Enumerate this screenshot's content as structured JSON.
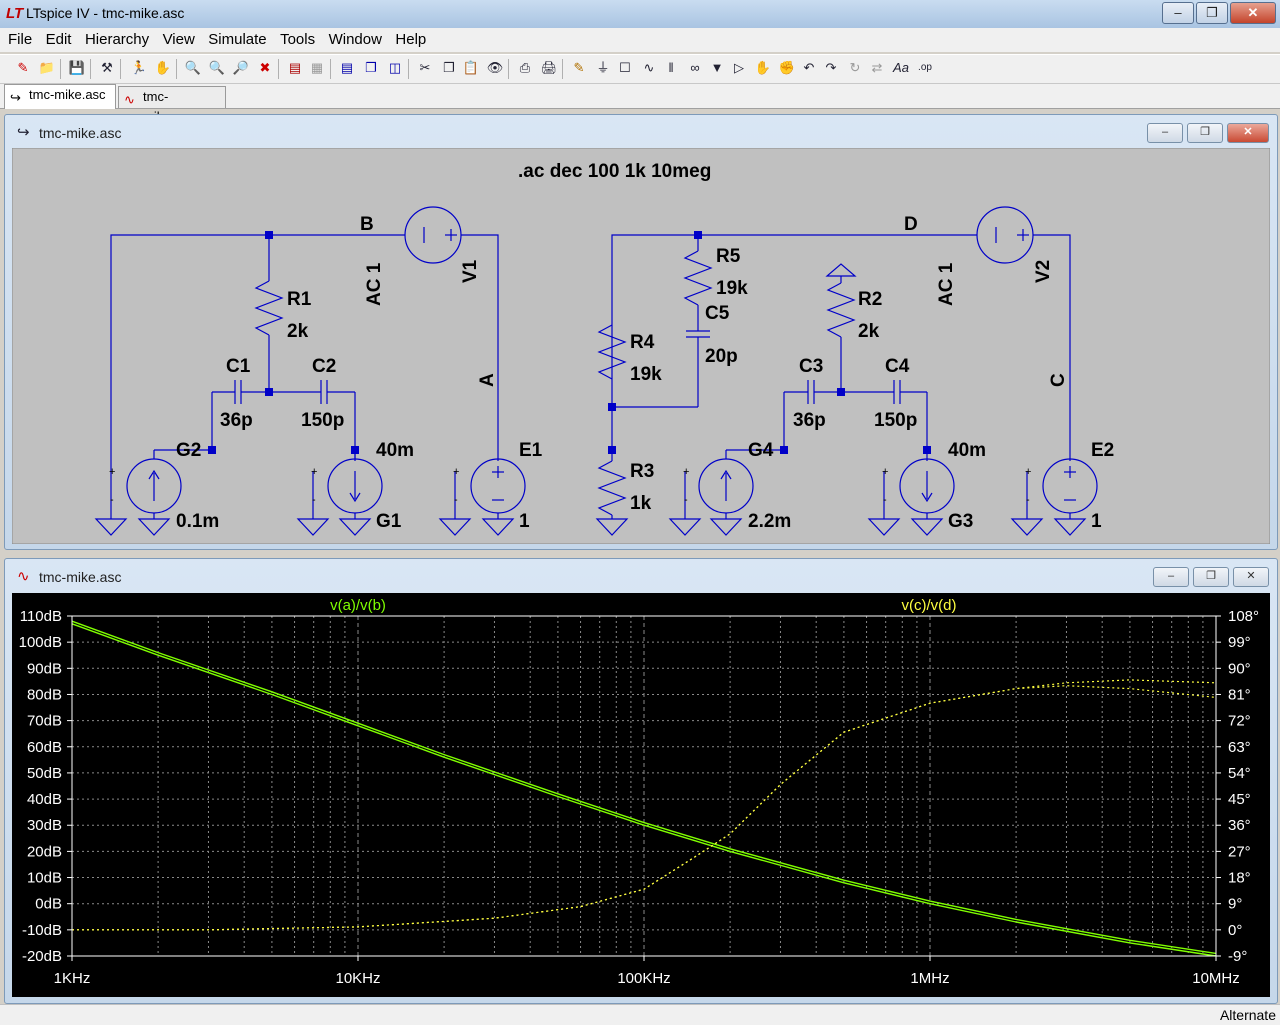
{
  "window": {
    "title": "LTspice IV - tmc-mike.asc"
  },
  "menu": [
    "File",
    "Edit",
    "Hierarchy",
    "View",
    "Simulate",
    "Tools",
    "Window",
    "Help"
  ],
  "tabs": [
    {
      "label": "tmc-mike.asc"
    },
    {
      "label": "tmc-mike.asc"
    }
  ],
  "schematic": {
    "title": "tmc-mike.asc",
    "directive": ".ac dec 100 1k 10meg",
    "labels": {
      "B": "B",
      "A": "A",
      "D": "D",
      "C": "C",
      "V1": "V1",
      "V2": "V2",
      "AC1a": "AC 1",
      "AC1b": "AC 1",
      "R1": "R1",
      "R1v": "2k",
      "R2": "R2",
      "R2v": "2k",
      "R3": "R3",
      "R3v": "1k",
      "R4": "R4",
      "R4v": "19k",
      "R5": "R5",
      "R5v": "19k",
      "C1": "C1",
      "C1v": "36p",
      "C2": "C2",
      "C2v": "150p",
      "C3": "C3",
      "C3v": "36p",
      "C4": "C4",
      "C4v": "150p",
      "C5": "C5",
      "C5v": "20p",
      "G2": "G2",
      "G2v": "0.1m",
      "G1": "G1",
      "G1v": "40m",
      "G4": "G4",
      "G4v": "2.2m",
      "G3": "G3",
      "G3v": "40m",
      "E1": "E1",
      "E1v": "1",
      "E2": "E2",
      "E2v": "1"
    }
  },
  "plot": {
    "title": "tmc-mike.asc",
    "trace1_label": "v(a)/v(b)",
    "trace2_label": "v(c)/v(d)",
    "colors": {
      "trace1": "#7fff00",
      "trace2": "#ffff40",
      "grid": "#8a8a8a",
      "text": "#ffffff"
    }
  },
  "chart_data": {
    "type": "line",
    "x_scale": "log",
    "xlim": [
      1000,
      10000000
    ],
    "x_ticks": [
      "1KHz",
      "10KHz",
      "100KHz",
      "1MHz",
      "10MHz"
    ],
    "y_left_ticks": [
      "110dB",
      "100dB",
      "90dB",
      "80dB",
      "70dB",
      "60dB",
      "50dB",
      "40dB",
      "30dB",
      "20dB",
      "10dB",
      "0dB",
      "-10dB",
      "-20dB"
    ],
    "y_right_ticks": [
      "108°",
      "99°",
      "90°",
      "81°",
      "72°",
      "63°",
      "54°",
      "45°",
      "36°",
      "27°",
      "18°",
      "9°",
      "0°",
      "-9°"
    ],
    "ylim_left": [
      -20,
      110
    ],
    "ylim_right": [
      -9,
      108
    ],
    "series": [
      {
        "name": "v(a)/v(b)",
        "axis": "left",
        "style": "solid",
        "x": [
          1000,
          2000,
          5000,
          10000,
          20000,
          50000,
          100000,
          200000,
          500000,
          1000000,
          2000000,
          5000000,
          10000000
        ],
        "y": [
          108,
          96,
          81,
          69,
          57,
          42,
          31,
          21,
          9,
          1,
          -6,
          -14,
          -19
        ]
      },
      {
        "name": "v(a)/v(b)",
        "axis": "left",
        "style": "solid",
        "x": [
          1000,
          2000,
          5000,
          10000,
          20000,
          50000,
          100000,
          200000,
          500000,
          1000000,
          2000000,
          5000000,
          10000000
        ],
        "y": [
          107,
          95,
          80,
          68,
          56,
          41,
          30,
          20,
          8,
          0,
          -7,
          -15,
          -20
        ]
      },
      {
        "name": "v(c)/v(d)",
        "axis": "right",
        "style": "dotted",
        "x": [
          1000,
          3000,
          10000,
          30000,
          60000,
          100000,
          150000,
          200000,
          300000,
          500000,
          1000000,
          2000000,
          3000000,
          5000000,
          10000000
        ],
        "y": [
          0,
          0,
          1,
          4,
          8,
          14,
          25,
          33,
          50,
          68,
          78,
          83,
          84,
          83,
          80
        ]
      },
      {
        "name": "v(c)/v(d)",
        "axis": "right",
        "style": "dotted",
        "x": [
          1000,
          3000,
          10000,
          30000,
          60000,
          100000,
          150000,
          200000,
          300000,
          500000,
          1000000,
          2000000,
          3000000,
          5000000,
          10000000
        ],
        "y": [
          0,
          0,
          1,
          4,
          8,
          14,
          25,
          33,
          50,
          68,
          78,
          83,
          85,
          86,
          85
        ]
      }
    ]
  },
  "status": {
    "text": "Alternate"
  }
}
